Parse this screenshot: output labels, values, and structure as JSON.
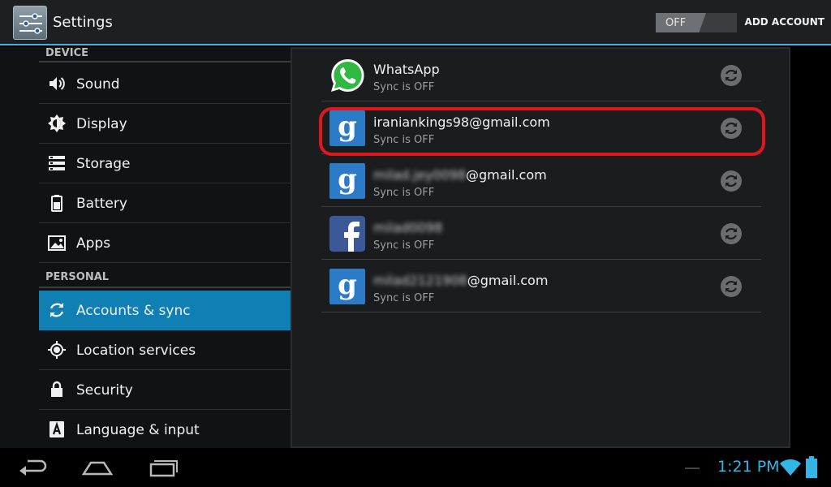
{
  "actionbar": {
    "title": "Settings",
    "toggle_label": "OFF",
    "add_account": "ADD ACCOUNT"
  },
  "sidebar": {
    "device_header": "DEVICE",
    "personal_header": "PERSONAL",
    "items": [
      {
        "label": "Sound",
        "icon": "speaker-icon"
      },
      {
        "label": "Display",
        "icon": "brightness-icon"
      },
      {
        "label": "Storage",
        "icon": "storage-icon"
      },
      {
        "label": "Battery",
        "icon": "battery-icon"
      },
      {
        "label": "Apps",
        "icon": "apps-icon"
      },
      {
        "label": "Accounts & sync",
        "icon": "sync-icon",
        "selected": true
      },
      {
        "label": "Location services",
        "icon": "location-icon"
      },
      {
        "label": "Security",
        "icon": "lock-icon"
      },
      {
        "label": "Language & input",
        "icon": "keyboard-icon"
      }
    ]
  },
  "accounts": [
    {
      "name": "WhatsApp",
      "status": "Sync is OFF",
      "icon": "whatsapp-icon"
    },
    {
      "name": "iraniankings98@gmail.com",
      "status": "Sync is OFF",
      "icon": "google-icon",
      "highlighted": true
    },
    {
      "name_blur": "milad.jey0098",
      "name_suffix": "@gmail.com",
      "status": "Sync is OFF",
      "icon": "google-icon"
    },
    {
      "name_blur": "milad0098",
      "name_suffix": "",
      "status": "Sync is OFF",
      "icon": "facebook-icon"
    },
    {
      "name_blur": "milad2121908",
      "name_suffix": "@gmail.com",
      "status": "Sync is OFF",
      "icon": "google-icon"
    }
  ],
  "statusbar": {
    "time": "1:21 PM"
  },
  "colors": {
    "accent": "#33b5e5",
    "selected": "#0f7fb4",
    "highlight_ring": "#e0161f"
  }
}
